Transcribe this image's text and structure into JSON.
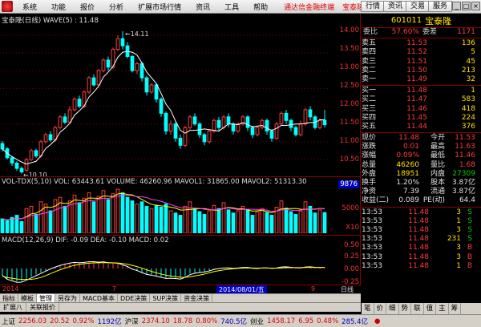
{
  "menu": {
    "items": [
      "系统",
      "功能",
      "报价",
      "分析",
      "扩展市场行情",
      "资讯",
      "工具",
      "帮助"
    ],
    "promo1": "通达信金融终端",
    "promo2": "宝泰隆",
    "right_buttons": [
      "行情",
      "资讯",
      "交易",
      "服务"
    ]
  },
  "chart": {
    "title": "宝泰隆(日线) WAVE(5) : 11.48",
    "price_ticks": [
      "14.00",
      "13.50",
      "13.00",
      "12.50",
      "12.00",
      "11.50",
      "11.00",
      "10.50"
    ],
    "high_label": "14.11",
    "low_label": "10.10",
    "vol_title": "VOL-TDX(5,10) VOL: 63443.61  VOLUME: 46260.96  MAVOL1: 31865.00  MAVOL2: 51313.30",
    "vol_ticks": [
      "9876",
      "5000",
      "X10"
    ],
    "macd_title": "MACD(12,26,9) DIF: -0.09  DEA: -0.10  MACD: 0.02",
    "macd_ticks": [
      "0.50",
      "0.25",
      "0.00",
      "-0.25"
    ],
    "x_year": "2014",
    "x_month": "7",
    "x_date": "2014/08/01/五",
    "x_9": "9",
    "x_right": "日线",
    "candles": [
      [
        10.95,
        10.8,
        11.02,
        10.72
      ],
      [
        10.8,
        10.55,
        10.85,
        10.5
      ],
      [
        10.55,
        10.4,
        10.6,
        10.32
      ],
      [
        10.4,
        10.25,
        10.45,
        10.18
      ],
      [
        10.25,
        10.15,
        10.3,
        10.1
      ],
      [
        10.2,
        10.5,
        10.55,
        10.15
      ],
      [
        10.5,
        10.75,
        10.8,
        10.45
      ],
      [
        10.75,
        10.6,
        10.8,
        10.55
      ],
      [
        10.6,
        11.0,
        11.05,
        10.55
      ],
      [
        11.0,
        11.2,
        11.25,
        10.95
      ],
      [
        11.2,
        11.05,
        11.3,
        11.0
      ],
      [
        11.05,
        11.4,
        11.45,
        11.0
      ],
      [
        11.4,
        11.7,
        11.75,
        11.35
      ],
      [
        11.7,
        11.55,
        11.8,
        11.5
      ],
      [
        11.55,
        11.9,
        12.0,
        11.5
      ],
      [
        11.9,
        12.2,
        12.25,
        11.85
      ],
      [
        12.2,
        12.0,
        12.3,
        11.95
      ],
      [
        12.0,
        12.4,
        12.45,
        11.95
      ],
      [
        12.4,
        12.8,
        12.85,
        12.35
      ],
      [
        12.8,
        12.6,
        12.9,
        12.55
      ],
      [
        12.6,
        13.0,
        13.05,
        12.55
      ],
      [
        13.0,
        13.3,
        13.35,
        12.95
      ],
      [
        13.3,
        13.1,
        13.4,
        13.0
      ],
      [
        13.1,
        13.6,
        13.65,
        13.05
      ],
      [
        13.6,
        13.9,
        14.0,
        13.55
      ],
      [
        13.9,
        13.7,
        14.11,
        13.6
      ],
      [
        13.7,
        13.4,
        13.8,
        13.35
      ],
      [
        13.4,
        13.0,
        13.45,
        12.95
      ],
      [
        13.0,
        13.2,
        13.25,
        12.9
      ],
      [
        13.2,
        12.8,
        13.25,
        12.7
      ],
      [
        12.8,
        12.4,
        12.85,
        12.3
      ],
      [
        12.4,
        12.6,
        12.65,
        12.35
      ],
      [
        12.6,
        12.2,
        12.65,
        12.1
      ],
      [
        12.2,
        11.8,
        12.25,
        11.7
      ],
      [
        11.8,
        11.3,
        11.85,
        11.2
      ],
      [
        11.3,
        11.5,
        11.6,
        11.2
      ],
      [
        11.5,
        11.1,
        11.55,
        11.0
      ],
      [
        11.1,
        10.9,
        11.2,
        10.8
      ],
      [
        10.9,
        11.4,
        11.45,
        10.85
      ],
      [
        11.4,
        11.7,
        11.75,
        11.35
      ],
      [
        11.7,
        11.5,
        11.8,
        11.45
      ],
      [
        11.5,
        11.2,
        11.55,
        11.1
      ],
      [
        11.2,
        11.0,
        11.25,
        10.9
      ],
      [
        11.0,
        11.3,
        11.35,
        10.95
      ],
      [
        11.3,
        11.6,
        11.65,
        11.25
      ],
      [
        11.6,
        11.4,
        11.7,
        11.3
      ],
      [
        11.4,
        11.7,
        11.75,
        11.35
      ],
      [
        11.7,
        11.5,
        11.8,
        11.4
      ],
      [
        11.5,
        11.3,
        11.55,
        11.2
      ],
      [
        11.3,
        11.5,
        11.55,
        11.25
      ],
      [
        11.5,
        11.7,
        11.75,
        11.45
      ],
      [
        11.7,
        11.4,
        11.75,
        11.3
      ],
      [
        11.4,
        11.2,
        11.45,
        11.1
      ],
      [
        11.2,
        11.4,
        11.45,
        11.15
      ],
      [
        11.4,
        11.6,
        11.65,
        11.35
      ],
      [
        11.6,
        11.3,
        11.65,
        11.2
      ],
      [
        11.3,
        11.1,
        11.35,
        11.0
      ],
      [
        11.1,
        11.5,
        11.55,
        11.05
      ],
      [
        11.5,
        11.8,
        11.85,
        11.45
      ],
      [
        11.8,
        11.6,
        11.9,
        11.5
      ],
      [
        11.6,
        11.4,
        11.65,
        11.3
      ],
      [
        11.4,
        11.2,
        11.45,
        11.15
      ],
      [
        11.2,
        11.5,
        11.6,
        11.15
      ],
      [
        11.5,
        11.9,
        11.95,
        11.45
      ],
      [
        11.9,
        11.7,
        12.0,
        11.6
      ],
      [
        11.7,
        11.4,
        11.75,
        11.35
      ],
      [
        11.4,
        11.6,
        11.65,
        11.35
      ],
      [
        11.6,
        11.48,
        11.9,
        11.4
      ]
    ],
    "volumes": [
      3.2,
      2.8,
      3.5,
      4.0,
      2.6,
      5.5,
      6.0,
      4.2,
      7.0,
      6.5,
      5.0,
      7.5,
      8.0,
      6.0,
      7.2,
      8.5,
      6.8,
      7.8,
      9.0,
      7.0,
      8.2,
      9.5,
      7.5,
      8.8,
      9.8,
      9.0,
      8.0,
      7.2,
      6.5,
      7.0,
      6.0,
      5.5,
      6.2,
      5.8,
      6.5,
      5.0,
      4.5,
      4.0,
      6.0,
      7.0,
      5.5,
      4.8,
      4.2,
      5.0,
      6.2,
      5.5,
      6.8,
      5.2,
      4.5,
      5.0,
      6.0,
      5.2,
      4.0,
      4.8,
      5.5,
      4.6,
      4.0,
      5.8,
      7.2,
      5.6,
      4.8,
      4.2,
      5.0,
      7.0,
      6.0,
      4.5,
      5.2,
      4.6
    ],
    "macd": [
      -0.15,
      -0.2,
      -0.22,
      -0.25,
      -0.24,
      -0.2,
      -0.16,
      -0.12,
      -0.08,
      -0.04,
      0.0,
      0.03,
      0.06,
      0.08,
      0.1,
      0.11,
      0.1,
      0.11,
      0.12,
      0.12,
      0.11,
      0.12,
      0.1,
      0.1,
      0.09,
      0.06,
      0.03,
      -0.02,
      -0.04,
      -0.08,
      -0.11,
      -0.12,
      -0.14,
      -0.16,
      -0.18,
      -0.17,
      -0.18,
      -0.19,
      -0.15,
      -0.1,
      -0.08,
      -0.07,
      -0.06,
      -0.04,
      -0.01,
      0.0,
      0.01,
      0.01,
      0.0,
      0.01,
      0.02,
      0.02,
      0.0,
      0.0,
      0.01,
      0.01,
      0.0,
      0.01,
      0.03,
      0.03,
      0.02,
      0.01,
      0.01,
      0.03,
      0.03,
      0.02,
      0.02,
      0.02
    ]
  },
  "quote": {
    "code": "601011",
    "name": "宝泰隆",
    "weibi_label": "委比",
    "weibi": "57.60%",
    "weicha_label": "委差",
    "weicha": "1171",
    "sells": [
      {
        "l": "卖五",
        "p": "11.53",
        "v": "136"
      },
      {
        "l": "卖四",
        "p": "11.52",
        "v": "5"
      },
      {
        "l": "卖三",
        "p": "11.51",
        "v": "45"
      },
      {
        "l": "卖二",
        "p": "11.50",
        "v": "213"
      },
      {
        "l": "卖一",
        "p": "11.49",
        "v": "32"
      }
    ],
    "buys": [
      {
        "l": "买一",
        "p": "11.48",
        "v": "1"
      },
      {
        "l": "买二",
        "p": "11.47",
        "v": "583"
      },
      {
        "l": "买三",
        "p": "11.46",
        "v": "418"
      },
      {
        "l": "买四",
        "p": "11.45",
        "v": "224"
      },
      {
        "l": "买五",
        "p": "11.44",
        "v": "376"
      }
    ],
    "stats": [
      {
        "a": "现价",
        "av": "11.48",
        "b": "今开",
        "bv": "11.53"
      },
      {
        "a": "涨跌",
        "av": "0.01",
        "b": "最高",
        "bv": "11.63"
      },
      {
        "a": "涨幅",
        "av": "0.09%",
        "b": "最低",
        "bv": "11.46"
      },
      {
        "a": "总量",
        "av": "46260",
        "b": "量比",
        "bv": "1.68"
      },
      {
        "a": "外盘",
        "av": "18951",
        "b": "内盘",
        "bv": "27309"
      },
      {
        "a": "换手",
        "av": "1.20%",
        "b": "股本",
        "bv": "3.87亿"
      },
      {
        "a": "净资",
        "av": "7.39",
        "b": "流通",
        "bv": "3.87亿"
      },
      {
        "a": "收益(二)",
        "av": "0.089",
        "b": "PE(动)",
        "bv": "64.4"
      }
    ],
    "ticks": [
      {
        "t": "13:53",
        "p": "11.48",
        "v": "3",
        "s": "S"
      },
      {
        "t": "13:53",
        "p": "11.48",
        "v": "1",
        "s": "S"
      },
      {
        "t": "13:53",
        "p": "11.48",
        "v": "3",
        "s": "S"
      },
      {
        "t": "13:53",
        "p": "11.48",
        "v": "231",
        "s": "S"
      },
      {
        "t": "13:53",
        "p": "11.48",
        "v": "3",
        "s": "B"
      },
      {
        "t": "13:53",
        "p": "11.48",
        "v": "3",
        "s": "B"
      },
      {
        "t": "13:53",
        "p": "11.48",
        "v": "1",
        "s": "B"
      }
    ]
  },
  "tabs": [
    "指标",
    "模板",
    "管理",
    "另存为",
    "MACD基本",
    "DDE决策",
    "SUP决策",
    "资金决策"
  ],
  "tabs2": [
    "扩展八",
    "关联报价"
  ],
  "right_tabs": [
    "笔",
    "价",
    "细",
    "势",
    "联",
    "值",
    "主",
    "筹"
  ],
  "status": {
    "sh_label": "上证",
    "sh": "2256.03",
    "sh_ch": "20.52",
    "sh_pct": "0.92%",
    "sh_amt": "1192亿",
    "hs_label": "沪深",
    "hs": "2374.10",
    "hs_ch": "18.78",
    "hs_pct": "0.80%",
    "hs_amt": "740.5亿",
    "cy_label": "创业",
    "cy": "1458.17",
    "cy_ch": "6.95",
    "cy_pct": "0.48%",
    "cy_amt": "285.4亿"
  },
  "colors": {
    "up": "#ff3c3c",
    "down": "#00ffff",
    "ma": "#ffffff",
    "grid": "#800000"
  }
}
